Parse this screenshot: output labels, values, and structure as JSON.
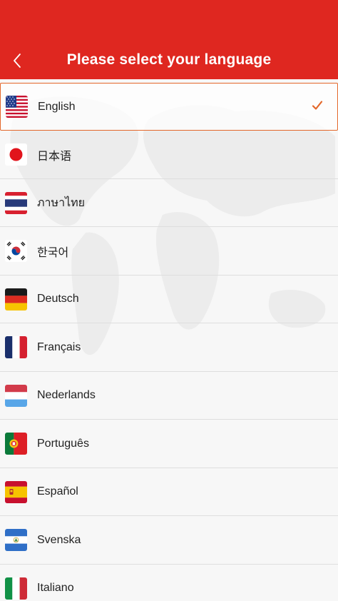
{
  "header": {
    "title": "Please select your language",
    "back_icon": "chevron-left-icon",
    "background_color": "#df2720"
  },
  "languages": [
    {
      "label": "English",
      "flag": "us-flag-icon",
      "selected": true
    },
    {
      "label": "日本语",
      "flag": "japan-flag-icon",
      "selected": false
    },
    {
      "label": "ภาษาไทย",
      "flag": "thailand-flag-icon",
      "selected": false
    },
    {
      "label": "한국어",
      "flag": "korea-flag-icon",
      "selected": false
    },
    {
      "label": "Deutsch",
      "flag": "germany-flag-icon",
      "selected": false
    },
    {
      "label": "Français",
      "flag": "france-flag-icon",
      "selected": false
    },
    {
      "label": "Nederlands",
      "flag": "netherlands-flag-icon",
      "selected": false
    },
    {
      "label": "Português",
      "flag": "portugal-flag-icon",
      "selected": false
    },
    {
      "label": "Español",
      "flag": "spain-flag-icon",
      "selected": false
    },
    {
      "label": "Svenska",
      "flag": "el-salvador-flag-icon",
      "selected": false
    },
    {
      "label": "Italiano",
      "flag": "italy-flag-icon",
      "selected": false
    }
  ],
  "selected_check_icon": "checkmark-icon",
  "accent_color": "#e3672a"
}
